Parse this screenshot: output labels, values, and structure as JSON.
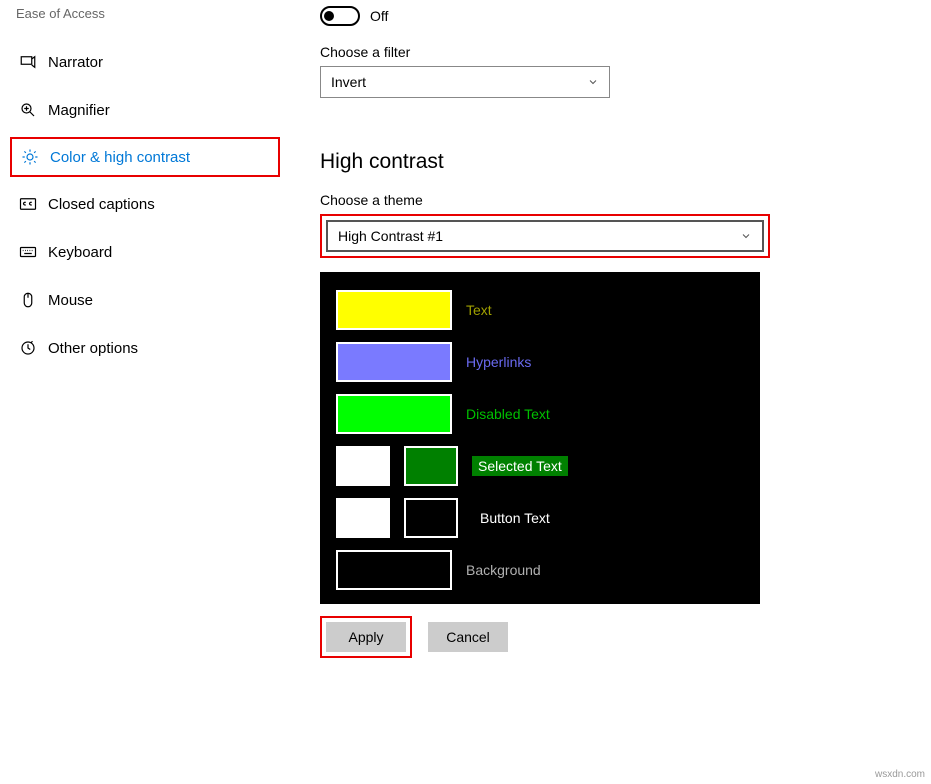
{
  "sidebar": {
    "title": "Ease of Access",
    "items": [
      {
        "label": "Narrator"
      },
      {
        "label": "Magnifier"
      },
      {
        "label": "Color & high contrast"
      },
      {
        "label": "Closed captions"
      },
      {
        "label": "Keyboard"
      },
      {
        "label": "Mouse"
      },
      {
        "label": "Other options"
      }
    ]
  },
  "toggle": {
    "label": "Off"
  },
  "filter": {
    "label": "Choose a filter",
    "value": "Invert"
  },
  "section_title": "High contrast",
  "theme": {
    "label": "Choose a theme",
    "value": "High Contrast #1"
  },
  "preview": {
    "text": {
      "label": "Text",
      "color": "#ffff00",
      "label_color": "#a0a000"
    },
    "hyperlinks": {
      "label": "Hyperlinks",
      "color": "#7a7aff",
      "label_color": "#6a6af0"
    },
    "disabled": {
      "label": "Disabled Text",
      "color": "#00ff00",
      "label_color": "#00c000"
    },
    "selected": {
      "label": "Selected Text",
      "fg": "#ffffff",
      "bg": "#008000"
    },
    "button": {
      "label": "Button Text",
      "fg": "#ffffff",
      "bg": "#000000",
      "label_color": "#ffffff"
    },
    "background": {
      "label": "Background",
      "color": "#000000",
      "label_color": "#b0b0b0"
    }
  },
  "buttons": {
    "apply": "Apply",
    "cancel": "Cancel"
  },
  "watermark": "wsxdn.com"
}
